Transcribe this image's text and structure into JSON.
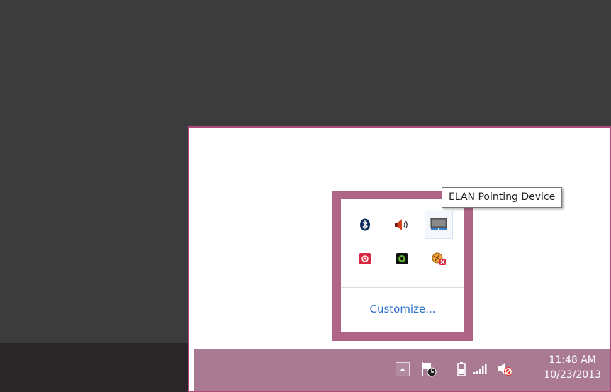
{
  "tooltip": {
    "text": "ELAN Pointing Device"
  },
  "tray_popup": {
    "icons": [
      {
        "name": "bluetooth-icon"
      },
      {
        "name": "speaker-icon"
      },
      {
        "name": "elan-pointing-device-icon"
      },
      {
        "name": "red-app-icon"
      },
      {
        "name": "green-eye-icon"
      },
      {
        "name": "yellow-warning-network-icon"
      }
    ],
    "customize_label": "Customize..."
  },
  "taskbar": {
    "clock": {
      "time": "11:48 AM",
      "date": "10/23/2013"
    }
  },
  "colors": {
    "frame_border": "#b04a7c",
    "taskbar": "#a97a91",
    "popup_border": "#ae6586",
    "link": "#2a6fc9"
  }
}
